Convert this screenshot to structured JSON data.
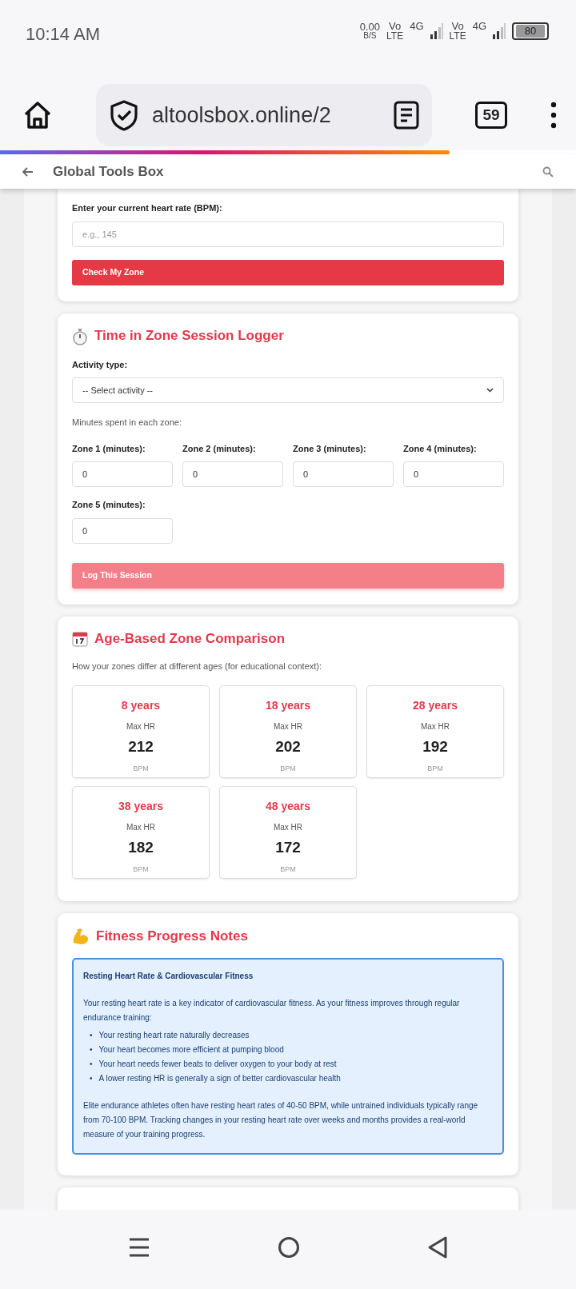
{
  "status_bar": {
    "time": "10:14 AM",
    "net_speed": "0.00",
    "net_unit": "B/S",
    "sims": [
      {
        "volte": "Vo",
        "volte_sub": "LTE",
        "network": "4G"
      },
      {
        "volte": "Vo",
        "volte_sub": "LTE",
        "network": "4G"
      }
    ],
    "battery": "80"
  },
  "browser": {
    "url": "altoolsbox.online/2",
    "tab_count": "59",
    "load_progress": {
      "level": 0.78
    }
  },
  "app_bar": {
    "title": "Global Tools Box"
  },
  "workout_tracker": {
    "label": "Enter your current heart rate (BPM):",
    "input": {
      "placeholder": "e.g., 145"
    },
    "button": "Check My Zone"
  },
  "session_logger": {
    "title": "Time in Zone Session Logger",
    "activity_label": "Activity type:",
    "activity_select": {
      "value": "-- Select activity --"
    },
    "minutes_hint": "Minutes spent in each zone:",
    "zones": [
      {
        "label": "Zone 1 (minutes):",
        "value": "0"
      },
      {
        "label": "Zone 2 (minutes):",
        "value": "0"
      },
      {
        "label": "Zone 3 (minutes):",
        "value": "0"
      },
      {
        "label": "Zone 4 (minutes):",
        "value": "0"
      },
      {
        "label": "Zone 5 (minutes):",
        "value": "0"
      }
    ],
    "button": {
      "label": "Log This Session",
      "disabled": true
    }
  },
  "age_comparison": {
    "title": "Age-Based Zone Comparison",
    "subtitle": "How your zones differ at different ages (for educational context):",
    "ages": [
      {
        "age": "8 years",
        "metric": "Max HR",
        "value": "212",
        "unit": "BPM"
      },
      {
        "age": "18 years",
        "metric": "Max HR",
        "value": "202",
        "unit": "BPM"
      },
      {
        "age": "28 years",
        "metric": "Max HR",
        "value": "192",
        "unit": "BPM"
      },
      {
        "age": "38 years",
        "metric": "Max HR",
        "value": "182",
        "unit": "BPM"
      },
      {
        "age": "48 years",
        "metric": "Max HR",
        "value": "172",
        "unit": "BPM"
      }
    ]
  },
  "progress_notes": {
    "title": "Fitness Progress Notes",
    "note": {
      "heading": "Resting Heart Rate & Cardiovascular Fitness",
      "intro": "Your resting heart rate is a key indicator of cardiovascular fitness. As your fitness improves through regular endurance training:",
      "bullets": [
        {
          "marker": "•",
          "text": "Your resting heart rate naturally decreases"
        },
        {
          "marker": "•",
          "text": "Your heart becomes more efficient at pumping blood"
        },
        {
          "marker": "•",
          "text": "Your heart needs fewer beats to deliver oxygen to your body at rest"
        },
        {
          "marker": "•",
          "text": "A lower resting HR is generally a sign of better cardiovascular health"
        }
      ],
      "closing": "Elite endurance athletes often have resting heart rates of 40-50 BPM, while untrained individuals typically range from 70-100 BPM. Tracking changes in your resting heart rate over weeks and months provides a real-world measure of your training progress."
    }
  }
}
